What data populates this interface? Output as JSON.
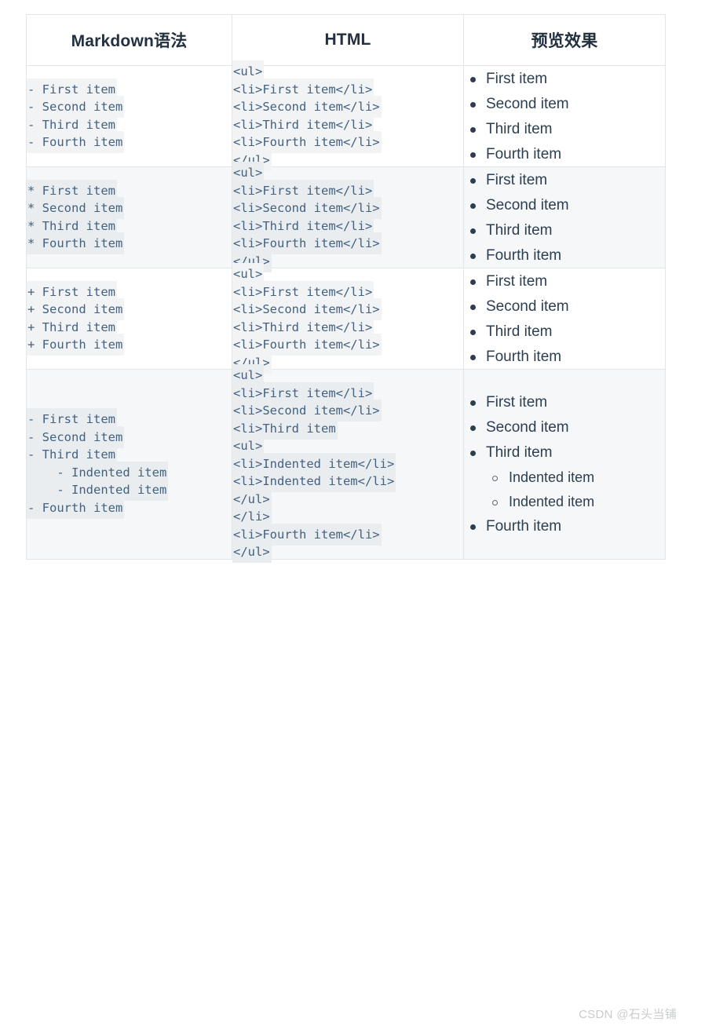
{
  "table": {
    "headers": [
      {
        "label": "Markdown语法"
      },
      {
        "label": "HTML"
      },
      {
        "label": "预览效果"
      }
    ],
    "rows": [
      {
        "stripe": false,
        "markdown": [
          "- First item",
          "- Second item",
          "- Third item",
          "- Fourth item"
        ],
        "html": [
          "<ul>",
          "<li>First item</li>",
          "<li>Second item</li>",
          "<li>Third item</li>",
          "<li>Fourth item</li>",
          "</ul>"
        ],
        "preview": [
          {
            "level": 1,
            "text": "First item"
          },
          {
            "level": 1,
            "text": "Second item"
          },
          {
            "level": 1,
            "text": "Third item"
          },
          {
            "level": 1,
            "text": "Fourth item"
          }
        ]
      },
      {
        "stripe": true,
        "markdown": [
          "* First item",
          "* Second item",
          "* Third item",
          "* Fourth item"
        ],
        "html": [
          "<ul>",
          "<li>First item</li>",
          "<li>Second item</li>",
          "<li>Third item</li>",
          "<li>Fourth item</li>",
          "</ul>"
        ],
        "preview": [
          {
            "level": 1,
            "text": "First item"
          },
          {
            "level": 1,
            "text": "Second item"
          },
          {
            "level": 1,
            "text": "Third item"
          },
          {
            "level": 1,
            "text": "Fourth item"
          }
        ]
      },
      {
        "stripe": false,
        "markdown": [
          "+ First item",
          "+ Second item",
          "+ Third item",
          "+ Fourth item"
        ],
        "html": [
          "<ul>",
          "<li>First item</li>",
          "<li>Second item</li>",
          "<li>Third item</li>",
          "<li>Fourth item</li>",
          "</ul>"
        ],
        "preview": [
          {
            "level": 1,
            "text": "First item"
          },
          {
            "level": 1,
            "text": "Second item"
          },
          {
            "level": 1,
            "text": "Third item"
          },
          {
            "level": 1,
            "text": "Fourth item"
          }
        ]
      },
      {
        "stripe": true,
        "markdown": [
          "- First item",
          "- Second item",
          "- Third item",
          "    - Indented item",
          "    - Indented item",
          "- Fourth item"
        ],
        "html": [
          "<ul>",
          "<li>First item</li>",
          "<li>Second item</li>",
          "<li>Third item",
          "<ul>",
          "<li>Indented item</li>",
          "<li>Indented item</li>",
          "</ul>",
          "</li>",
          "<li>Fourth item</li>",
          "</ul>"
        ],
        "preview": [
          {
            "level": 1,
            "text": "First item"
          },
          {
            "level": 1,
            "text": "Second item"
          },
          {
            "level": 1,
            "text": "Third item"
          },
          {
            "level": 2,
            "text": "Indented item"
          },
          {
            "level": 2,
            "text": "Indented item"
          },
          {
            "level": 1,
            "text": "Fourth item"
          }
        ]
      }
    ]
  },
  "watermark": {
    "text": "CSDN @石头当铺"
  },
  "colors": {
    "header_text": "#22303f",
    "code_text": "#44617f",
    "code_highlight": "#f1f3f5",
    "code_highlight_alt": "#e9edf0",
    "preview_text": "#2c3e50",
    "row_stripe": "#f5f7f9",
    "border": "#e3e6e8",
    "watermark_text": "#c9cbcd"
  }
}
